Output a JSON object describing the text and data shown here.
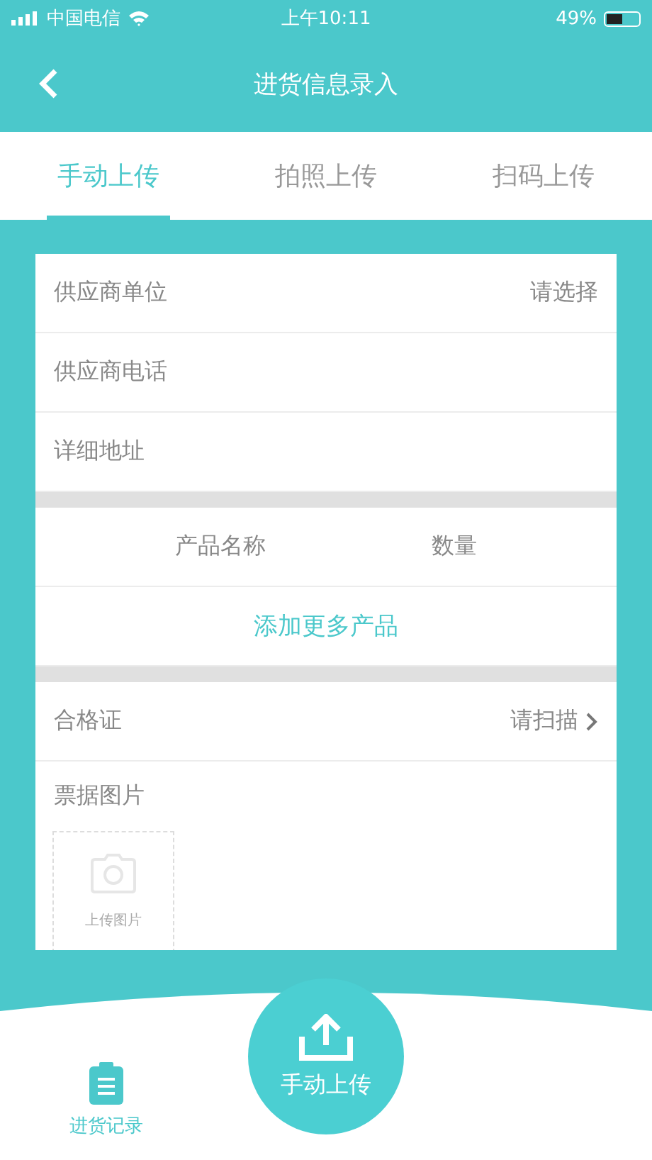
{
  "status_bar": {
    "carrier": "中国电信",
    "time": "上午10:11",
    "battery": "49%"
  },
  "header": {
    "title": "进货信息录入"
  },
  "tabs": [
    {
      "label": "手动上传",
      "selected": true
    },
    {
      "label": "拍照上传",
      "selected": false
    },
    {
      "label": "扫码上传",
      "selected": false
    }
  ],
  "supplier_fields": [
    {
      "label": "供应商单位",
      "value": "请选择"
    },
    {
      "label": "供应商电话"
    },
    {
      "label": "详细地址"
    }
  ],
  "product_columns": [
    "产品名称",
    "数量"
  ],
  "add_product": "添加更多产品",
  "certificate": {
    "label": "合格证",
    "value": "请扫描"
  },
  "receipt": {
    "label": "票据图片",
    "upload_label": "上传图片"
  },
  "upload_button": {
    "label": "手动上传"
  },
  "bottom_tabs": [
    {
      "label": "进货记录",
      "selected": true
    }
  ]
}
